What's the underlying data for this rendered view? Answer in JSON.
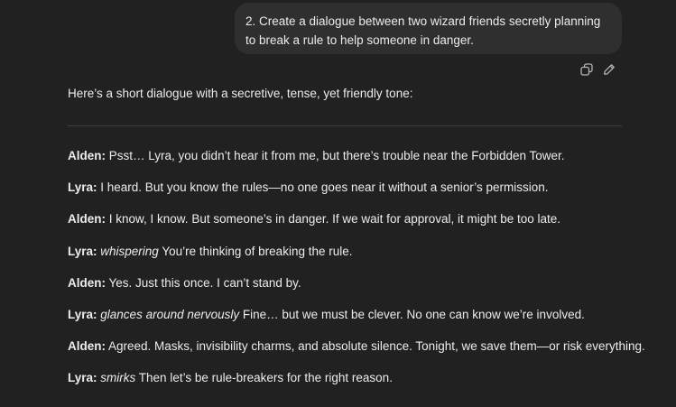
{
  "user_message": {
    "text": "2. Create a dialogue between two wizard friends secretly planning to break a rule to help someone in danger."
  },
  "message_actions": {
    "icons": [
      "copy-icon",
      "edit-icon"
    ]
  },
  "assistant": {
    "intro": "Here’s a short dialogue with a secretive, tense, yet friendly tone:",
    "dialogue": [
      {
        "speaker": "Alden:",
        "action": "",
        "text": "Psst… Lyra, you didn’t hear it from me, but there’s trouble near the Forbidden Tower."
      },
      {
        "speaker": "Lyra:",
        "action": "",
        "text": "I heard. But you know the rules—no one goes near it without a senior’s permission."
      },
      {
        "speaker": "Alden:",
        "action": "",
        "text": "I know, I know. But someone’s in danger. If we wait for approval, it might be too late."
      },
      {
        "speaker": "Lyra:",
        "action": "whispering",
        "text": "You’re thinking of breaking the rule."
      },
      {
        "speaker": "Alden:",
        "action": "",
        "text": "Yes. Just this once. I can’t stand by."
      },
      {
        "speaker": "Lyra:",
        "action": "glances around nervously",
        "text": "Fine… but we must be clever. No one can know we’re involved."
      },
      {
        "speaker": "Alden:",
        "action": "",
        "text": "Agreed. Masks, invisibility charms, and absolute silence. Tonight, we save them—or risk everything."
      },
      {
        "speaker": "Lyra:",
        "action": "smirks",
        "text": "Then let’s be rule-breakers for the right reason."
      }
    ]
  }
}
